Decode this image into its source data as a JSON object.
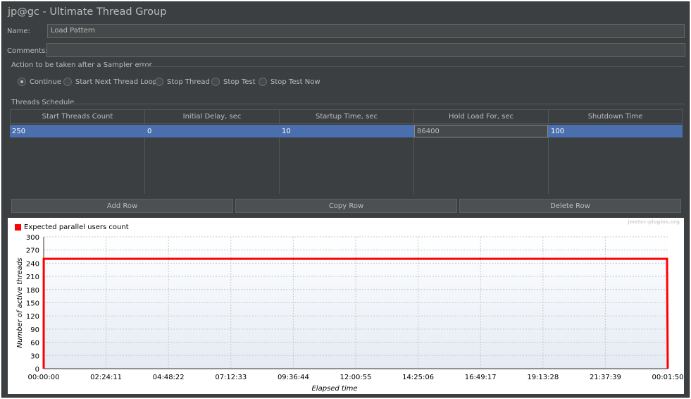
{
  "window": {
    "title": "jp@gc - Ultimate Thread Group"
  },
  "name_label": "Name:",
  "name_value": "Load Pattern",
  "comments_label": "Comments:",
  "comments_value": "",
  "sampler_error": {
    "legend": "Action to be taken after a Sampler error",
    "options": [
      "Continue",
      "Start Next Thread Loop",
      "Stop Thread",
      "Stop Test",
      "Stop Test Now"
    ],
    "selected": "Continue"
  },
  "schedule": {
    "legend": "Threads Schedule",
    "columns": [
      "Start Threads Count",
      "Initial Delay, sec",
      "Startup Time, sec",
      "Hold Load For, sec",
      "Shutdown Time"
    ],
    "rows": [
      [
        "250",
        "0",
        "10",
        "86400",
        "100"
      ]
    ]
  },
  "buttons": {
    "add": "Add Row",
    "copy": "Copy Row",
    "delete": "Delete Row"
  },
  "watermark": "jmeter-plugins.org",
  "colors": {
    "background": "#3c3f41",
    "selection": "#4b6eaf",
    "series": "#ff0000"
  },
  "chart_data": {
    "type": "line",
    "series": [
      {
        "name": "Expected parallel users count",
        "x": [
          "00:00:00",
          "00:00:10",
          "24:00:10",
          "24:01:50"
        ],
        "y": [
          0,
          250,
          250,
          0
        ]
      }
    ],
    "xlabel": "Elapsed time",
    "ylabel": "Number of active threads",
    "ylim": [
      0,
      300
    ],
    "yticks": [
      0,
      30,
      60,
      90,
      120,
      150,
      180,
      210,
      240,
      270,
      300
    ],
    "xticks": [
      "00:00:00",
      "02:24:11",
      "04:48:22",
      "07:12:33",
      "09:36:44",
      "12:00:55",
      "14:25:06",
      "16:49:17",
      "19:13:28",
      "21:37:39",
      "00:01:50"
    ],
    "grid": true,
    "legend_position": "top-left"
  }
}
